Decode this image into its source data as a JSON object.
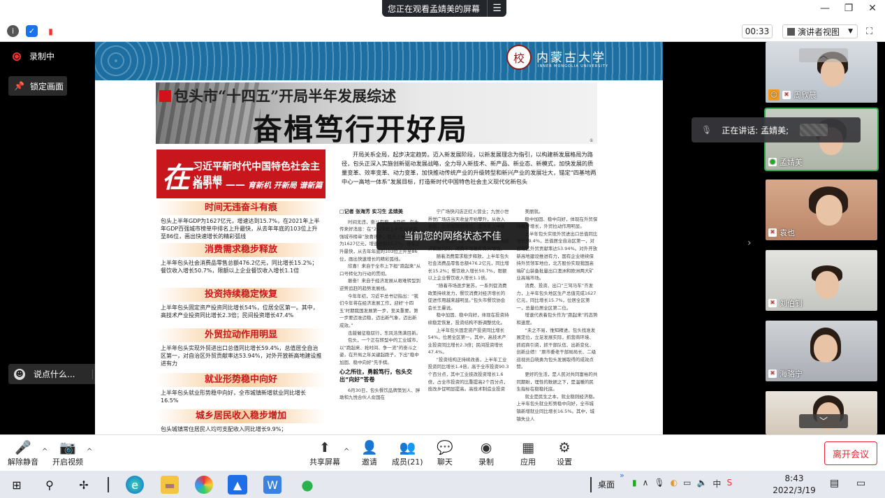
{
  "titlebar": {
    "share_text": "您正在观看孟婧美的屏幕",
    "menu_glyph": "☰",
    "minimize": "—",
    "restore": "❐",
    "close": "✕"
  },
  "toolbar": {
    "timer": "00:33",
    "view_label": "演讲者视图",
    "view_caret": "▼",
    "fullscreen_glyph": "⛶"
  },
  "left": {
    "recording": "录制中",
    "lock_screen": "锁定画面",
    "say_something": "说点什么...",
    "say_arrow": "‹"
  },
  "share": {
    "university": "内蒙古大学",
    "university_en": "INNER MONGOLIA UNIVERSITY",
    "subtitle": "包头市“十四五”开局半年发展综述",
    "headline": "奋楫笃行开好局",
    "page_marker": "①",
    "red_box": {
      "zai": "在",
      "line1": "习近平新时代中国特色社会主义思想",
      "line2": "指引下 ——",
      "line2_slogan": "育新机 开新局 谱新篇"
    },
    "sections": [
      {
        "title": "时间无违奋斗有痕",
        "body": "包头上半年GDP为1627亿元，增速达到15.7%，在2021年上半年GDP百强城市榜单中排名上升最快，从去年年底的103位上升至86位，画出快速增长的精彩弧线"
      },
      {
        "title": "消费需求稳步释放",
        "body": "上半年包头社会消费品零售总额476.2亿元，同比增长15.2%；餐饮收入增长50.7%，限额以上企业餐饮收入增长1.1倍"
      },
      {
        "title": "投资持续稳定恢复",
        "body": "上半年包头固定资产投资同比增长54%，位居全区第一。其中，高技术产业投资同比增长2.3倍；民间投资增长47.4%"
      },
      {
        "title": "外贸拉动作用明显",
        "body": "上半年包头实现外贸进出口总值同比增长59.4%，总值居全自治区第一，对自治区外贸贡献率达53.94%，对外开放新高地建设推进有力"
      },
      {
        "title": "就业形势稳中向好",
        "body": "上半年包头就业形势稳中向好，全市城镇新增就业同比增长16.5%"
      },
      {
        "title": "城乡居民收入稳步增加",
        "body": "包头城镇常住居民人均可支配收入同比增长9.9%；"
      }
    ],
    "intro": "开局关系全局，起步决定趋势。迈入新发展阶段，以新发展理念为指引，以构建新发展格局为路径，包头正深入实施创新驱动发展战略，全力导入新技术、新产品、新业态、新模式，加快发展的质量变革、效率变革、动力变革，加快推动传统产业的升级转型和新兴产业的发展壮大，锚定“四基地两中心一高地一体系”发展目标，打造新时代中国特色社会主义现代化新包头",
    "col1_byline": "□记者 张海芳 实习生 孟婧美",
    "col1_p1": "时间无违，奋斗有痕。8月初，包头传来好消息：在“2021年上半年GDP百强城市榜单”放喜讯中，包头上半年GDP为1627亿元，增速达到15.7%，排名上升最快，从去年年底的103位上升至86位，画出快速增长的精彩弧线。",
    "col1_p2": "欣喜！来自于全市上下担“跑起来”从口号转化为行动的贯彻。",
    "col1_p3": "振奋！来自于经济发展从艰难转型到逆势追赶的趋势发展线。",
    "col1_p4": "今年年初，习近平总书记指出：“我们今年将在经济发展工作，迎好‘十四五’时期我国发展第一步，至关重要。第一步要迈准迈稳，迈出新气象，迈出新成效。”",
    "col1_p5": "击鼓催征稳驭行，东风浩荡满目新。",
    "col1_p6": "包头，一个正在转型中的工业城市，以“跑起来、抢时间、争一流”的奋斗之姿，在开局之年关键起跑子，下出“稳中加固、稳中向好”先手棋。",
    "col1_sub": "心之所往，勇毅笃行，包头交出“向好”答卷",
    "col1_p7": "6月30日，包头餐饮品牌策划人、胖墩和九悦合伙人俞国在",
    "col2_p1": "宁广场快闪店正红火营业；九悦小世界悦广场店当天收益开始攀升，从收入来看，比去年同期增加，是今年上半年包头经济稳中加固、稳中向好的缩影。",
    "col2_p2": "稳中加固、稳中向好，体现在服务经济恢复向好，消费市场复苏势头增强。",
    "col2_p3": "随着消费需求稳步释放，上半年包头社会消费品零售总额476.2亿元，同比增长15.2%；餐饮收入增长50.7%，限额以上企业餐饮收入增长1.1倍。",
    "col2_p4": "“随着市场逐步复苏，一系列促消费政策持续发力，餐饮消费对经济增长的促进作用越来越明显。”包头市餐饮协会会长王曼说。",
    "col2_p5": "稳中加固、稳中向好，体现在投资持续稳定恢复，投资结构不断调整优化。",
    "col2_p6": "上半年包头固定资产投资同比增长54%，位居全区第一。其中，高技术产业投资同比增长2.3倍；民间投资增长47.4%。",
    "col2_p7": "“投资结构正持续改善，上半年工业投资同比增长1.4倍，高于全市投资90.3个百分点，其中工业技改投资增长1.6倍，占全市投资的比重提高2个百分点，技改乡促明显提高。高技术制造业投资",
    "col3_p1": "美丽就。",
    "col3_p2": "稳中加固、稳中向好，体现在外贸保持稳步增长，外贸拉动作用明显。",
    "col3_p3": "上半年包头实现外贸进出口总值同比增长59.4%，总值居全自治区第一，对自治区外贸贡献率达53.94%。对外开放新高地建设推进有力，国有企业继续保持外贸领军地位，北方股份实现我国高端矿山装备批量出口澳洲和欧洲两大矿业高端市场。",
    "col3_p4": "消费、投资、出口“三驾马车”齐发力，上半年包头地区生产总值完成1627亿元，同比增长15.7%，位居全区第一，总量位居全区第二位。",
    "col3_p5": "增速代表着包头作为“跑起来”的态势和速度。",
    "col3_p6": "“未之不易，惟知精进。包头找准发展定位，立足发展实际，抓营商环境、抓招商引资，抓干部队伍、出新变化、创新业绩！”原市委老干部局局长、二级巡视员白晓勇为包头发展取得的成效点赞。",
    "col3_p7": "更好的生活，是人民对共同富裕的共同期盼，理性的数据之下，是温暖的民生指标在稳稳托底。",
    "col3_p8": "就业是民生之本，就业稳则经济稳。上半年包头就业形势稳中向好，全市城镇新增就业同比增长16.5%。其中，城镇失业人"
  },
  "network_message": "当前您的网络状态不佳",
  "speaking": {
    "label": "正在讲话: 孟婧美;"
  },
  "participants": [
    {
      "name": "周欣晨",
      "mic": "muted",
      "has_avatar": true
    },
    {
      "name": "孟婧美",
      "mic": "on",
      "has_avatar": false
    },
    {
      "name": "袁也",
      "mic": "muted",
      "has_avatar": false
    },
    {
      "name": "刘伯钊",
      "mic": "muted",
      "has_avatar": false
    },
    {
      "name": "海骆宁",
      "mic": "muted",
      "has_avatar": false
    }
  ],
  "plist_up": "︿",
  "plist_down": "﹀",
  "collapse_glyph": "›",
  "meeting_bar": {
    "unmute": "解除静音",
    "video": "开启视频",
    "share_screen": "共享屏幕",
    "invite": "邀请",
    "members": "成员(21)",
    "chat": "聊天",
    "record": "录制",
    "apps": "应用",
    "settings": "设置",
    "leave": "离开会议",
    "caret": "^"
  },
  "taskbar": {
    "desktop": "桌面",
    "tray_more": "»",
    "time": "8:43",
    "date": "2022/3/19",
    "ime": "中"
  }
}
